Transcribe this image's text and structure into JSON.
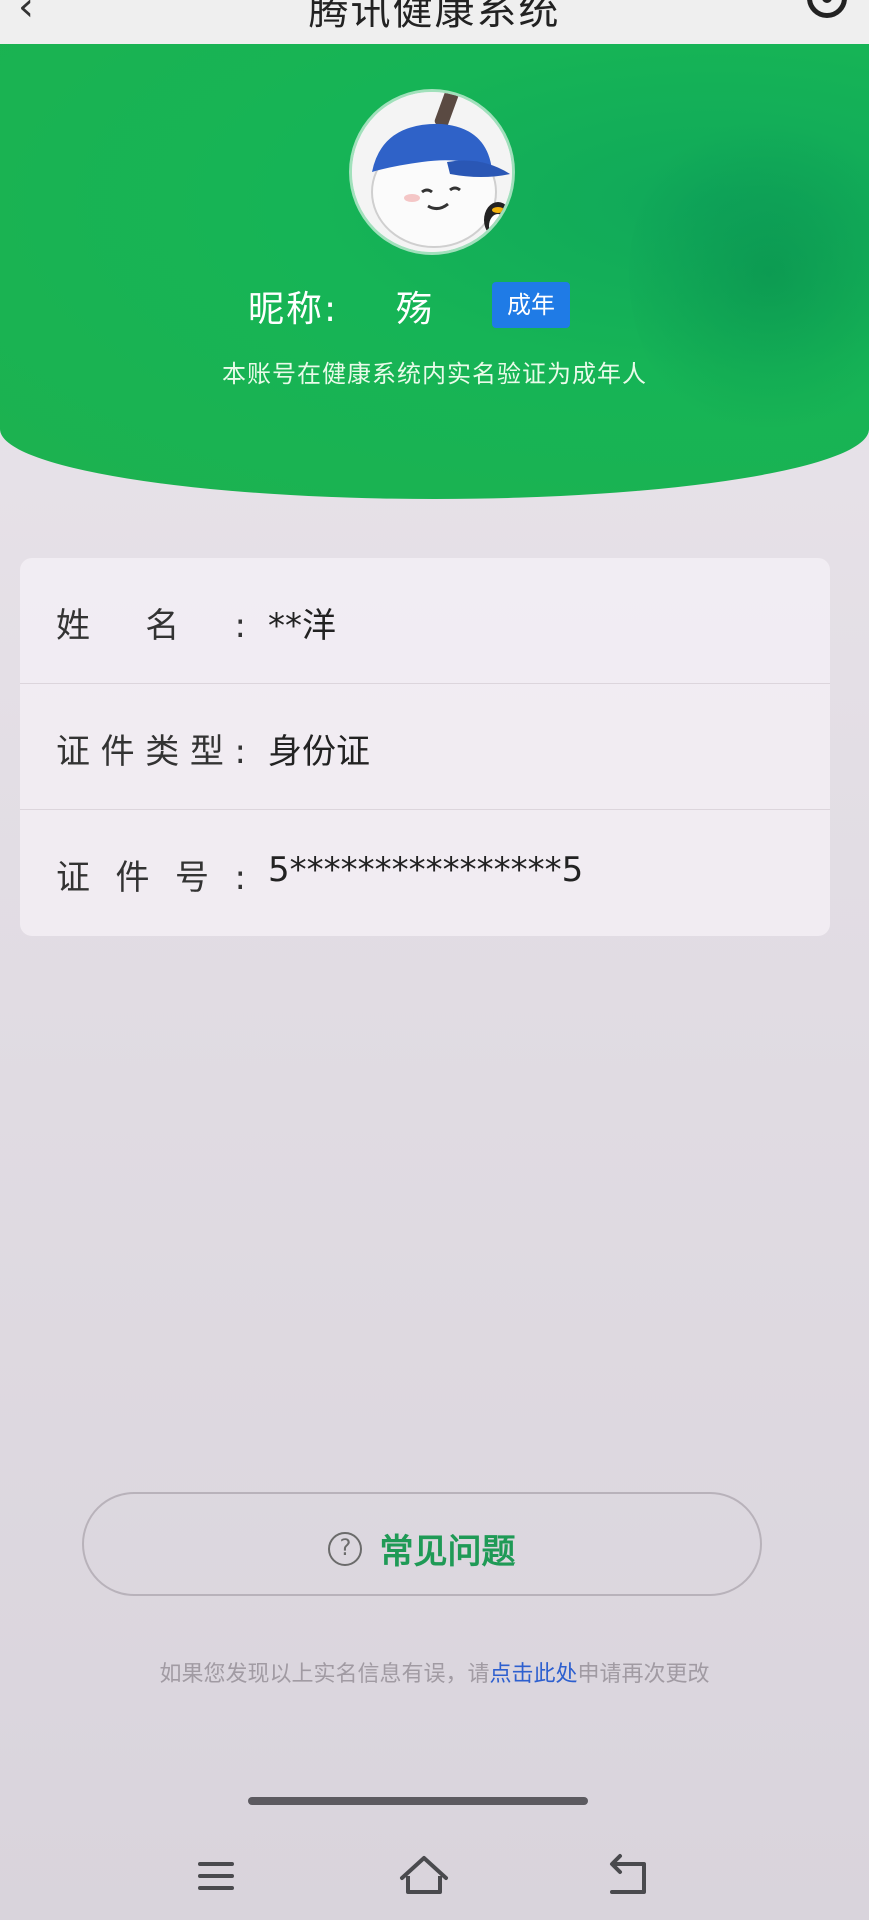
{
  "navbar": {
    "title": "腾讯健康系统",
    "back_icon": "back-arrow-icon",
    "more_icon": "more-options-icon"
  },
  "profile": {
    "nickname_label": "昵称:",
    "nickname": "殇",
    "badge": "成年",
    "verify_note": "本账号在健康系统内实名验证为成年人"
  },
  "info": {
    "rows": [
      {
        "label": "姓名:",
        "value": "**洋"
      },
      {
        "label": "证件类型:",
        "value": "身份证"
      },
      {
        "label": "证件号:",
        "value": "5****************5"
      }
    ]
  },
  "faq": {
    "icon": "question-circle-icon",
    "label": "常见问题"
  },
  "footnote": {
    "prefix": "如果您发现以上实名信息有误，请",
    "link": "点击此处",
    "suffix": "申请再次更改"
  },
  "colors": {
    "header_green": "#1db24f",
    "badge_blue": "#1f7be6",
    "link_blue": "#2d5fcf",
    "faq_green": "#1f9a56"
  },
  "system_nav": {
    "menu_icon": "menu-icon",
    "home_icon": "home-icon",
    "back_icon": "back-icon"
  }
}
